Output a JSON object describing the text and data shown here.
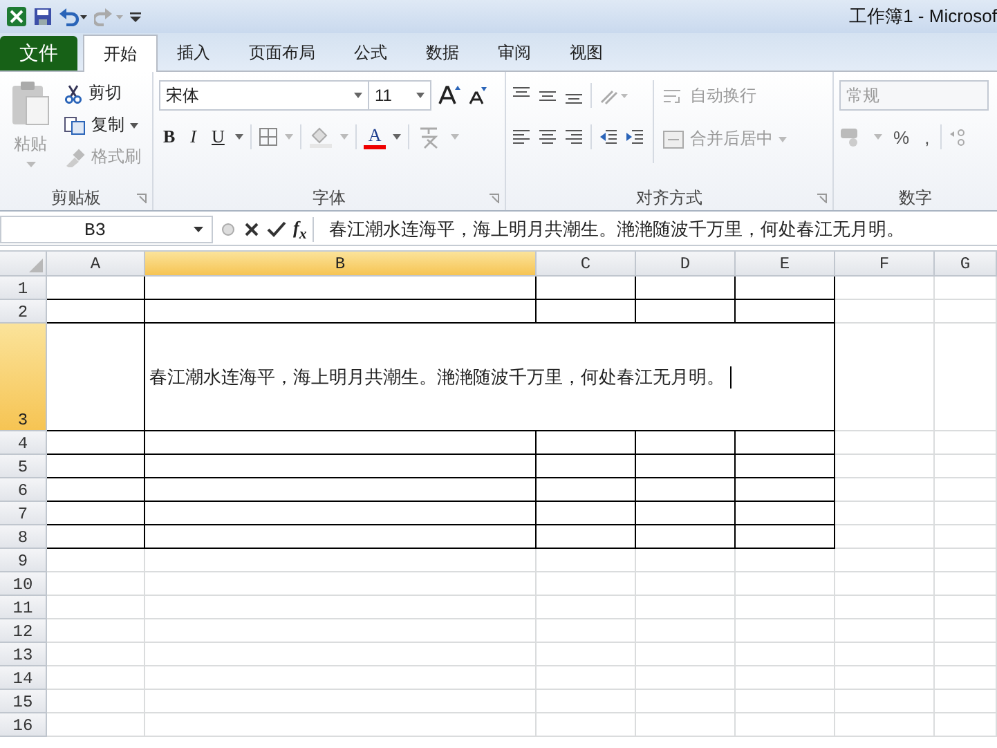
{
  "window": {
    "title": "工作簿1 - Microsof"
  },
  "tabs": [
    {
      "label": "文件",
      "kind": "file",
      "selected": false
    },
    {
      "label": "开始",
      "kind": "tab",
      "selected": true
    },
    {
      "label": "插入",
      "kind": "tab",
      "selected": false
    },
    {
      "label": "页面布局",
      "kind": "tab",
      "selected": false
    },
    {
      "label": "公式",
      "kind": "tab",
      "selected": false
    },
    {
      "label": "数据",
      "kind": "tab",
      "selected": false
    },
    {
      "label": "审阅",
      "kind": "tab",
      "selected": false
    },
    {
      "label": "视图",
      "kind": "tab",
      "selected": false
    }
  ],
  "ribbon": {
    "clipboard": {
      "label": "剪贴板",
      "paste": {
        "label": "粘贴",
        "disabled": true
      },
      "items": [
        {
          "label": "剪切",
          "kind": "cut",
          "disabled": false
        },
        {
          "label": "复制",
          "kind": "copy",
          "disabled": false
        },
        {
          "label": "格式刷",
          "kind": "brush",
          "disabled": true
        }
      ]
    },
    "font": {
      "label": "字体",
      "font_name": "宋体",
      "font_size": "11",
      "bold": "B",
      "italic": "I",
      "underline": "U",
      "font_color_letter": "A"
    },
    "alignment": {
      "label": "对齐方式",
      "wrap_text": {
        "label": "自动换行",
        "disabled": true
      },
      "merge_center": {
        "label": "合并后居中",
        "disabled": true
      }
    },
    "number": {
      "label": "数字",
      "format": {
        "value": "常规",
        "disabled": true
      },
      "percent": "%",
      "comma": ","
    }
  },
  "formula_bar": {
    "name_box": "B3",
    "function_button": "f$_{x}$",
    "formula": "春江潮水连海平，海上明月共潮生。滟滟随波千万里，何处春江无月明。"
  },
  "columns": [
    {
      "label": "A",
      "selected": false,
      "bordered": true
    },
    {
      "label": "B",
      "selected": true,
      "bordered": true
    },
    {
      "label": "C",
      "selected": false,
      "bordered": true
    },
    {
      "label": "D",
      "selected": false,
      "bordered": true
    },
    {
      "label": "E",
      "selected": false,
      "bordered": true
    },
    {
      "label": "F",
      "selected": false,
      "bordered": false
    },
    {
      "label": "G",
      "selected": false,
      "bordered": false
    }
  ],
  "rows": [
    {
      "label": "1",
      "selected": false,
      "bordered": true,
      "tall": false
    },
    {
      "label": "2",
      "selected": false,
      "bordered": true,
      "tall": false
    },
    {
      "label": "3",
      "selected": true,
      "bordered": true,
      "tall": true,
      "cells": {
        "B": {
          "text": "春江潮水连海平，海上明月共潮生。滟滟随波千万里，何处春江无月明。",
          "editing": true
        }
      }
    },
    {
      "label": "4",
      "selected": false,
      "bordered": true,
      "tall": false
    },
    {
      "label": "5",
      "selected": false,
      "bordered": true,
      "tall": false
    },
    {
      "label": "6",
      "selected": false,
      "bordered": true,
      "tall": false
    },
    {
      "label": "7",
      "selected": false,
      "bordered": true,
      "tall": false
    },
    {
      "label": "8",
      "selected": false,
      "bordered": true,
      "tall": false
    },
    {
      "label": "9",
      "selected": false,
      "bordered": false,
      "tall": false
    },
    {
      "label": "10",
      "selected": false,
      "bordered": false,
      "tall": false
    },
    {
      "label": "11",
      "selected": false,
      "bordered": false,
      "tall": false
    },
    {
      "label": "12",
      "selected": false,
      "bordered": false,
      "tall": false
    },
    {
      "label": "13",
      "selected": false,
      "bordered": false,
      "tall": false
    },
    {
      "label": "14",
      "selected": false,
      "bordered": false,
      "tall": false
    },
    {
      "label": "15",
      "selected": false,
      "bordered": false,
      "tall": false
    },
    {
      "label": "16",
      "selected": false,
      "bordered": false,
      "tall": false
    }
  ]
}
